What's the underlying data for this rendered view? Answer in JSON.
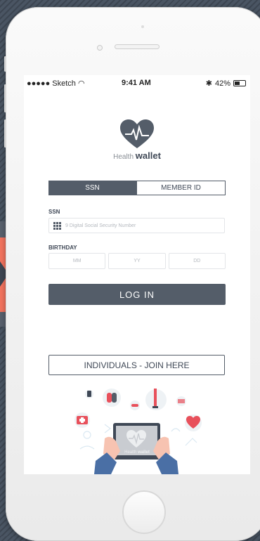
{
  "statusbar": {
    "carrier": "●●●●● Sketch",
    "time": "9:41 AM",
    "battery_text": "42%"
  },
  "logo": {
    "word1": "Health",
    "word2": "wallet"
  },
  "tabs": [
    {
      "label": "SSN",
      "active": true
    },
    {
      "label": "MEMBER ID",
      "active": false
    }
  ],
  "form": {
    "ssn_label": "SSN",
    "ssn_placeholder": "9 Digital Social Security Number",
    "birthday_label": "BIRTHDAY",
    "birthday_fields": [
      "MM",
      "YY",
      "DD"
    ]
  },
  "buttons": {
    "login": "LOG IN",
    "join": "INDIVIDUALS - JOIN HERE"
  },
  "illustration": {
    "tablet_word1": "Health",
    "tablet_word2": "wallet"
  },
  "colors": {
    "primary": "#545d69",
    "accent_red": "#f2735e",
    "heart_red": "#e8505b"
  }
}
